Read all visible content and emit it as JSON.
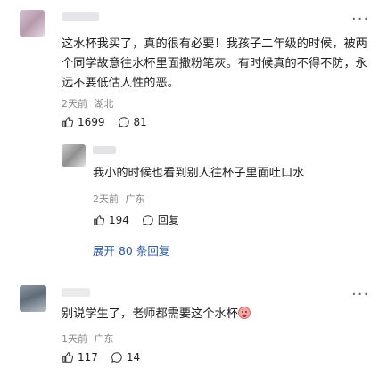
{
  "comments": [
    {
      "text": "这水杯我买了，真的很有必要！我孩子二年级的时候，被两个同学故意往水杯里面撒粉笔灰。有时候真的不得不防，永远不要低估人性的恶。",
      "time": "2天前",
      "location": "湖北",
      "likes": "1699",
      "comments_count": "81"
    },
    {
      "text": "我小的时候也看到别人往杯子里面吐口水",
      "time": "2天前",
      "location": "广东",
      "likes": "194",
      "reply_label": "回复"
    },
    {
      "text": "别说学生了，老师都需要这个水杯",
      "time": "1天前",
      "location": "广东",
      "likes": "117",
      "comments_count": "14"
    }
  ],
  "expand_replies": "展开 80 条回复",
  "more_label": "···",
  "colors": {
    "link": "#2d5aa0",
    "meta": "#8a8a8a"
  },
  "icons": {
    "like": "thumbs-up-icon",
    "comment": "comment-icon",
    "more": "more-dots-icon",
    "emoji": "laughing-emoji-icon"
  }
}
